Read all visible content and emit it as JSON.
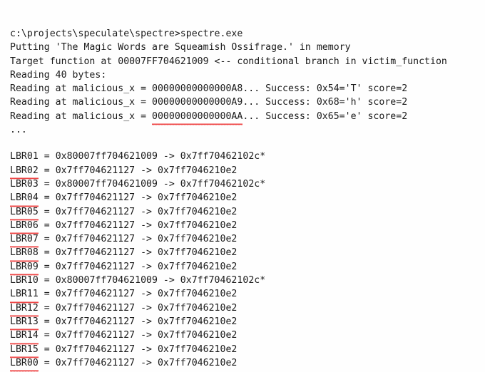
{
  "window": {
    "title": "spectre.exe console output",
    "background_color": "#fefefe",
    "text_color": "#1a1a1a",
    "squiggle_color": "#ec2b2b"
  },
  "intro": {
    "lines": [
      {
        "text": "c:\\projects\\speculate\\spectre>spectre.exe",
        "squiggle": null
      },
      {
        "text": "Putting 'The Magic Words are Squeamish Ossifrage.' in memory",
        "squiggle": null
      },
      {
        "text": "Target function at 00007FF704621009 <-- conditional branch in victim_function",
        "squiggle": null
      },
      {
        "text": "Reading 40 bytes:",
        "squiggle": null
      },
      {
        "text": "Reading at malicious_x = 00000000000000A8... Success: 0x54='T' score=2",
        "squiggle": null
      },
      {
        "text": "Reading at malicious_x = 00000000000000A9... Success: 0x68='h' score=2",
        "squiggle": null
      },
      {
        "pre": "Reading at malicious_x = ",
        "squiggle": "00000000000000AA",
        "post": "... Success: 0x65='e' score=2"
      },
      {
        "text": "...",
        "squiggle": null
      }
    ]
  },
  "lbr": {
    "lines": [
      {
        "label": "LBR01",
        "squiggle": false,
        "body": " = 0x80007ff704621009 -> 0x7ff70462102c*"
      },
      {
        "label": "LBR02",
        "squiggle": true,
        "body": " = 0x7ff704621127 -> 0x7ff7046210e2"
      },
      {
        "label": "LBR03",
        "squiggle": false,
        "body": " = 0x80007ff704621009 -> 0x7ff70462102c*"
      },
      {
        "label": "LBR04",
        "squiggle": true,
        "body": " = 0x7ff704621127 -> 0x7ff7046210e2"
      },
      {
        "label": "LBR05",
        "squiggle": true,
        "body": " = 0x7ff704621127 -> 0x7ff7046210e2"
      },
      {
        "label": "LBR06",
        "squiggle": true,
        "body": " = 0x7ff704621127 -> 0x7ff7046210e2"
      },
      {
        "label": "LBR07",
        "squiggle": true,
        "body": " = 0x7ff704621127 -> 0x7ff7046210e2"
      },
      {
        "label": "LBR08",
        "squiggle": true,
        "body": " = 0x7ff704621127 -> 0x7ff7046210e2"
      },
      {
        "label": "LBR09",
        "squiggle": true,
        "body": " = 0x7ff704621127 -> 0x7ff7046210e2"
      },
      {
        "label": "LBR10",
        "squiggle": false,
        "body": " = 0x80007ff704621009 -> 0x7ff70462102c*"
      },
      {
        "label": "LBR11",
        "squiggle": true,
        "body": " = 0x7ff704621127 -> 0x7ff7046210e2"
      },
      {
        "label": "LBR12",
        "squiggle": true,
        "body": " = 0x7ff704621127 -> 0x7ff7046210e2"
      },
      {
        "label": "LBR13",
        "squiggle": true,
        "body": " = 0x7ff704621127 -> 0x7ff7046210e2"
      },
      {
        "label": "LBR14",
        "squiggle": true,
        "body": " = 0x7ff704621127 -> 0x7ff7046210e2"
      },
      {
        "label": "LBR15",
        "squiggle": true,
        "body": " = 0x7ff704621127 -> 0x7ff7046210e2"
      },
      {
        "label": "LBR00",
        "squiggle": true,
        "body": " = 0x7ff704621127 -> 0x7ff7046210e2"
      }
    ]
  }
}
